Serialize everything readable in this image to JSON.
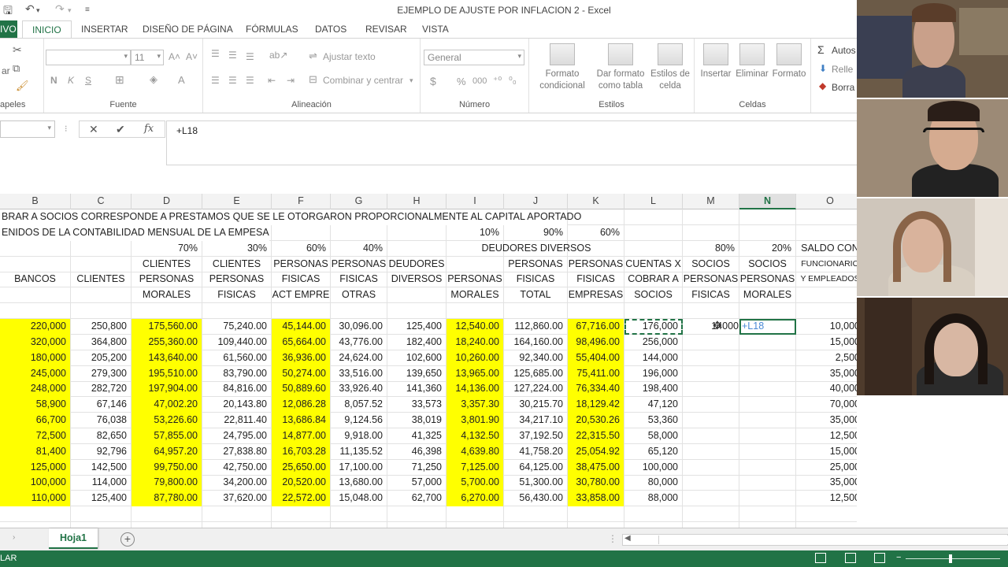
{
  "window_title": "EJEMPLO DE AJUSTE POR INFLACION 2 - Excel",
  "tabs": {
    "file": "IVO",
    "active": "INICIO",
    "others": [
      "INSERTAR",
      "DISEÑO DE PÁGINA",
      "FÓRMULAS",
      "DATOS",
      "REVISAR",
      "VISTA"
    ]
  },
  "ribbon": {
    "group_labels": {
      "clipboard": "apeles",
      "font": "Fuente",
      "alignment": "Alineación",
      "number": "Número",
      "styles": "Estilos",
      "cells": "Celdas"
    },
    "font_size": "11",
    "bold": "N",
    "italic": "K",
    "underline": "S",
    "wrap_text": "Ajustar texto",
    "merge_center": "Combinar y centrar",
    "number_format": "General",
    "currency": "$",
    "percent": "%",
    "thousands": "000",
    "cond_format": [
      "Formato",
      "condicional"
    ],
    "table_format": [
      "Dar formato",
      "como tabla"
    ],
    "cell_styles": [
      "Estilos de",
      "celda"
    ],
    "insert": "Insertar",
    "delete": "Eliminar",
    "format": "Formato",
    "autosum": "Autos",
    "fill": "Relle",
    "clear": "Borra"
  },
  "formula_bar": {
    "cancel": "✕",
    "enter": "✔",
    "fx": "fx",
    "formula": "+L18"
  },
  "columns": [
    "B",
    "C",
    "D",
    "E",
    "F",
    "G",
    "H",
    "I",
    "J",
    "K",
    "L",
    "M",
    "N",
    "O"
  ],
  "selected_column": "N",
  "text_rows": {
    "r1": "BRAR A SOCIOS CORRESPONDE A PRESTAMOS QUE SE LE OTORGARON PROPORCIONALMENTE AL CAPITAL APORTADO",
    "r2": "ENIDOS DE LA CONTABILIDAD MENSUAL DE LA EMPESA",
    "r2_pcts": [
      "10%",
      "90%",
      "60%"
    ],
    "r3_pcts": [
      "70%",
      "30%",
      "60%",
      "40%"
    ],
    "r3_deudores": "DEUDORES DIVERSOS",
    "r3_socios": [
      "80%",
      "20%"
    ],
    "r3_saldo": "SALDO CON"
  },
  "header_rows": {
    "row4": [
      "",
      "",
      "CLIENTES",
      "CLIENTES",
      "PERSONAS",
      "PERSONAS",
      "DEUDORES",
      "",
      "PERSONAS",
      "PERSONAS",
      "CUENTAS X",
      "SOCIOS",
      "SOCIOS",
      "FUNCIONARIO"
    ],
    "row5": [
      "BANCOS",
      "CLIENTES",
      "PERSONAS",
      "PERSONAS",
      "FISICAS",
      "FISICAS",
      "DIVERSOS",
      "PERSONAS",
      "FISICAS",
      "FISICAS",
      "COBRAR A",
      "PERSONAS",
      "PERSONAS",
      "Y EMPLEADOS"
    ],
    "row6": [
      "",
      "",
      "MORALES",
      "FISICAS",
      "ACT EMPRE",
      "OTRAS",
      "",
      "MORALES",
      "TOTAL",
      "EMPRESAS",
      "SOCIOS",
      "FISICAS",
      "MORALES",
      ""
    ]
  },
  "data_rows": [
    [
      "220,000",
      "250,800",
      "175,560.00",
      "75,240.00",
      "45,144.00",
      "30,096.00",
      "125,400",
      "12,540.00",
      "112,860.00",
      "67,716.00",
      "176,000",
      "14",
      "+L18",
      "10,000"
    ],
    [
      "320,000",
      "364,800",
      "255,360.00",
      "109,440.00",
      "65,664.00",
      "43,776.00",
      "182,400",
      "18,240.00",
      "164,160.00",
      "98,496.00",
      "256,000",
      "",
      "",
      "15,000"
    ],
    [
      "180,000",
      "205,200",
      "143,640.00",
      "61,560.00",
      "36,936.00",
      "24,624.00",
      "102,600",
      "10,260.00",
      "92,340.00",
      "55,404.00",
      "144,000",
      "",
      "",
      "2,500"
    ],
    [
      "245,000",
      "279,300",
      "195,510.00",
      "83,790.00",
      "50,274.00",
      "33,516.00",
      "139,650",
      "13,965.00",
      "125,685.00",
      "75,411.00",
      "196,000",
      "",
      "",
      "35,000"
    ],
    [
      "248,000",
      "282,720",
      "197,904.00",
      "84,816.00",
      "50,889.60",
      "33,926.40",
      "141,360",
      "14,136.00",
      "127,224.00",
      "76,334.40",
      "198,400",
      "",
      "",
      "40,000"
    ],
    [
      "58,900",
      "67,146",
      "47,002.20",
      "20,143.80",
      "12,086.28",
      "8,057.52",
      "33,573",
      "3,357.30",
      "30,215.70",
      "18,129.42",
      "47,120",
      "",
      "",
      "70,000"
    ],
    [
      "66,700",
      "76,038",
      "53,226.60",
      "22,811.40",
      "13,686.84",
      "9,124.56",
      "38,019",
      "3,801.90",
      "34,217.10",
      "20,530.26",
      "53,360",
      "",
      "",
      "35,000"
    ],
    [
      "72,500",
      "82,650",
      "57,855.00",
      "24,795.00",
      "14,877.00",
      "9,918.00",
      "41,325",
      "4,132.50",
      "37,192.50",
      "22,315.50",
      "58,000",
      "",
      "",
      "12,500"
    ],
    [
      "81,400",
      "92,796",
      "64,957.20",
      "27,838.80",
      "16,703.28",
      "11,135.52",
      "46,398",
      "4,639.80",
      "41,758.20",
      "25,054.92",
      "65,120",
      "",
      "",
      "15,000"
    ],
    [
      "125,000",
      "142,500",
      "99,750.00",
      "42,750.00",
      "25,650.00",
      "17,100.00",
      "71,250",
      "7,125.00",
      "64,125.00",
      "38,475.00",
      "100,000",
      "",
      "",
      "25,000"
    ],
    [
      "100,000",
      "114,000",
      "79,800.00",
      "34,200.00",
      "20,520.00",
      "13,680.00",
      "57,000",
      "5,700.00",
      "51,300.00",
      "30,780.00",
      "80,000",
      "",
      "",
      "35,000"
    ],
    [
      "110,000",
      "125,400",
      "87,780.00",
      "37,620.00",
      "22,572.00",
      "15,048.00",
      "62,700",
      "6,270.00",
      "56,430.00",
      "33,858.00",
      "88,000",
      "",
      "",
      "12,500"
    ]
  ],
  "m_cell_tail": "000",
  "sheet_tab": "Hoja1",
  "add_sheet": "+",
  "status": "LAR"
}
